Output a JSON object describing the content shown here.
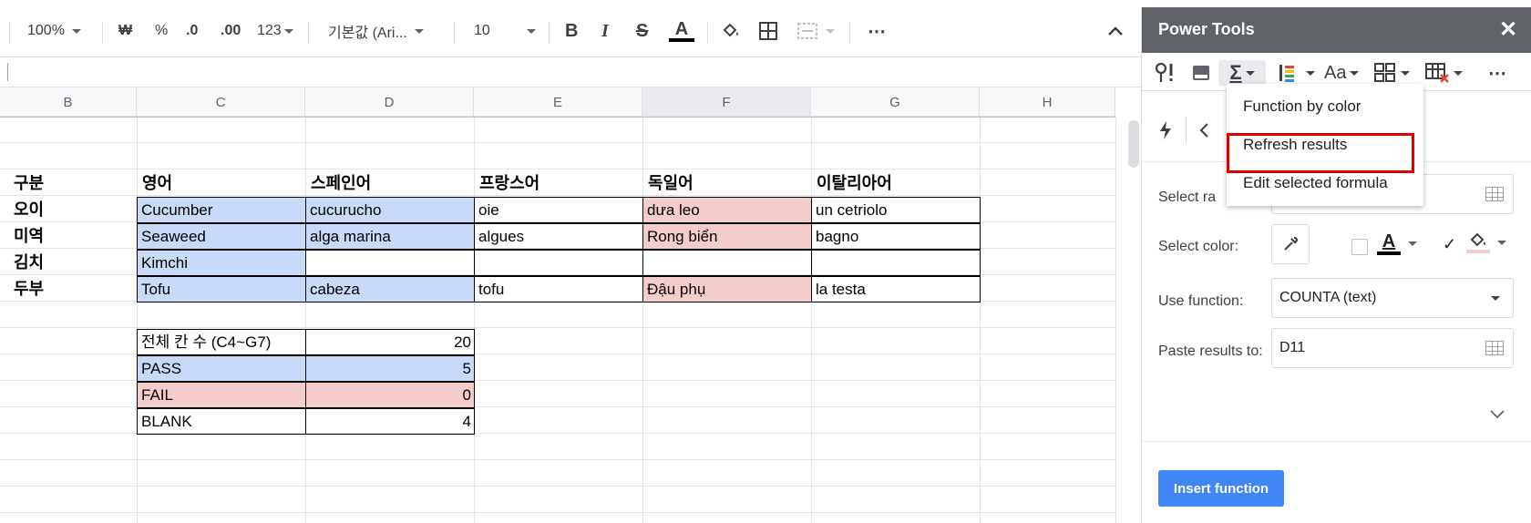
{
  "toolbar": {
    "zoom": "100%",
    "currency": "₩",
    "percent": "%",
    "decimal_decrease": ".0",
    "decimal_increase": ".00",
    "format_more": "123",
    "font": "기본값 (Ari...",
    "font_size": "10",
    "bold": "B",
    "italic": "I",
    "strike": "S",
    "text_color": "A",
    "more": "⋯",
    "collapse": "^"
  },
  "columns": [
    "B",
    "C",
    "D",
    "E",
    "F",
    "G",
    "H"
  ],
  "selected_column": "F",
  "table": {
    "header": [
      "구분",
      "영어",
      "스페인어",
      "프랑스어",
      "독일어",
      "이탈리아어"
    ],
    "rows": [
      {
        "label": "오이",
        "cells": [
          "Cucumber",
          "cucurucho",
          "oie",
          "dưa leo",
          "un cetriolo"
        ]
      },
      {
        "label": "미역",
        "cells": [
          "Seaweed",
          "alga marina",
          "algues",
          "Rong biển",
          "bagno"
        ]
      },
      {
        "label": "김치",
        "cells": [
          "Kimchi",
          "",
          "",
          "",
          ""
        ]
      },
      {
        "label": "두부",
        "cells": [
          "Tofu",
          "cabeza",
          "tofu",
          "Đậu phụ",
          "la testa"
        ]
      }
    ]
  },
  "summary": [
    {
      "label": "전체 칸 수 (C4~G7)",
      "value": "20"
    },
    {
      "label": "PASS",
      "value": "5"
    },
    {
      "label": "FAIL",
      "value": "0"
    },
    {
      "label": "BLANK",
      "value": "4"
    }
  ],
  "colors": {
    "blue_fill": "#c9daf8",
    "pink_fill": "#f4cccc",
    "panel_header": "#5f6368",
    "primary_button": "#4285f4",
    "highlight": "#e00000"
  },
  "panel": {
    "title": "Power Tools",
    "close": "✕",
    "tools": [
      "help-icon",
      "eraser-icon",
      "sigma-icon",
      "line-spacing-icon",
      "text-case-icon",
      "grid-layout-icon",
      "delete-table-icon",
      "more-icon"
    ],
    "select_range_label": "Select ra",
    "select_color_label": "Select color:",
    "use_function_label": "Use function:",
    "use_function_value": "COUNTA (text)",
    "paste_results_label": "Paste results to:",
    "paste_results_value": "D11",
    "font_color_letter": "A",
    "insert_button": "Insert function",
    "check_mark": "✓"
  },
  "dropdown": {
    "items": [
      "Function by color",
      "Refresh results",
      "Edit selected formula"
    ],
    "highlighted_index": 1
  }
}
